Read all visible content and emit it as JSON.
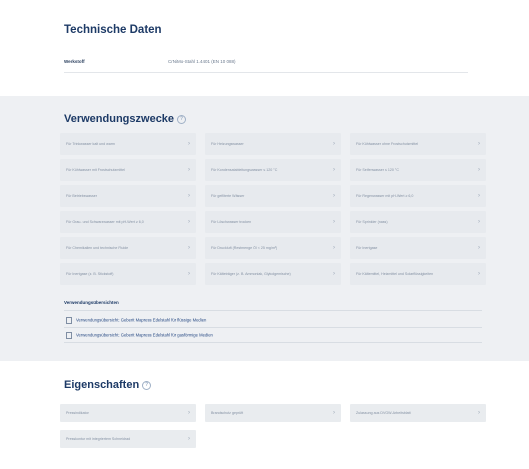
{
  "tech": {
    "title": "Technische Daten",
    "werkstoff_label": "Werkstoff",
    "werkstoff_value": "CrNiMo-Stahl 1.4401 (EN 10 088)"
  },
  "use": {
    "title": "Verwendungszwecke",
    "info": "?",
    "tiles": [
      "Für Trinkwasser kalt und warm",
      "Für Heizungswasser",
      "Für Kühlwasser ohne Frostschutzmittel",
      "Für Kühlwasser mit Frostschutzmittel",
      "Für Kondensatableitungswasser ≤ 120 °C",
      "Für Seifenwasser ≤ 120 °C",
      "Für Betriebswasser",
      "Für gefilterte Wässer",
      "Für Regenwasser mit pH-Wert ≥ 6,0",
      "Für Grau- und Schwarzwasser mit pH-Wert ≥ 6,0",
      "Für Löschwasser trocken",
      "Für Sprinkler (nass)",
      "Für Chemikalien und technische Fluide",
      "Für Druckluft (Restmenge Öl < 25 mg/m³)",
      "Für Inertgase",
      "Für Inertgase (z. B. Stickstoff)",
      "Für Kälteträger (z. B. Ammoniak, Glykolgemische)",
      "Für Kältemittel, Heizmittel und Solarflüssigkeiten"
    ],
    "chevron": "›"
  },
  "links": {
    "title": "Verwendungsübersichten",
    "items": [
      "Verwendungsübersicht: Geberit Mapress Edelstahl für flüssige Medien",
      "Verwendungsübersicht: Geberit Mapress Edelstahl für gasförmige Medien"
    ]
  },
  "props": {
    "title": "Eigenschaften",
    "info": "?",
    "tiles": [
      "Pressindikator",
      "Brandschutz geprüft",
      "Zulassung aus DVGW-Arbeitsblatt",
      "Presskontur mit integriertem Schneidrad"
    ],
    "chevron": "›"
  }
}
